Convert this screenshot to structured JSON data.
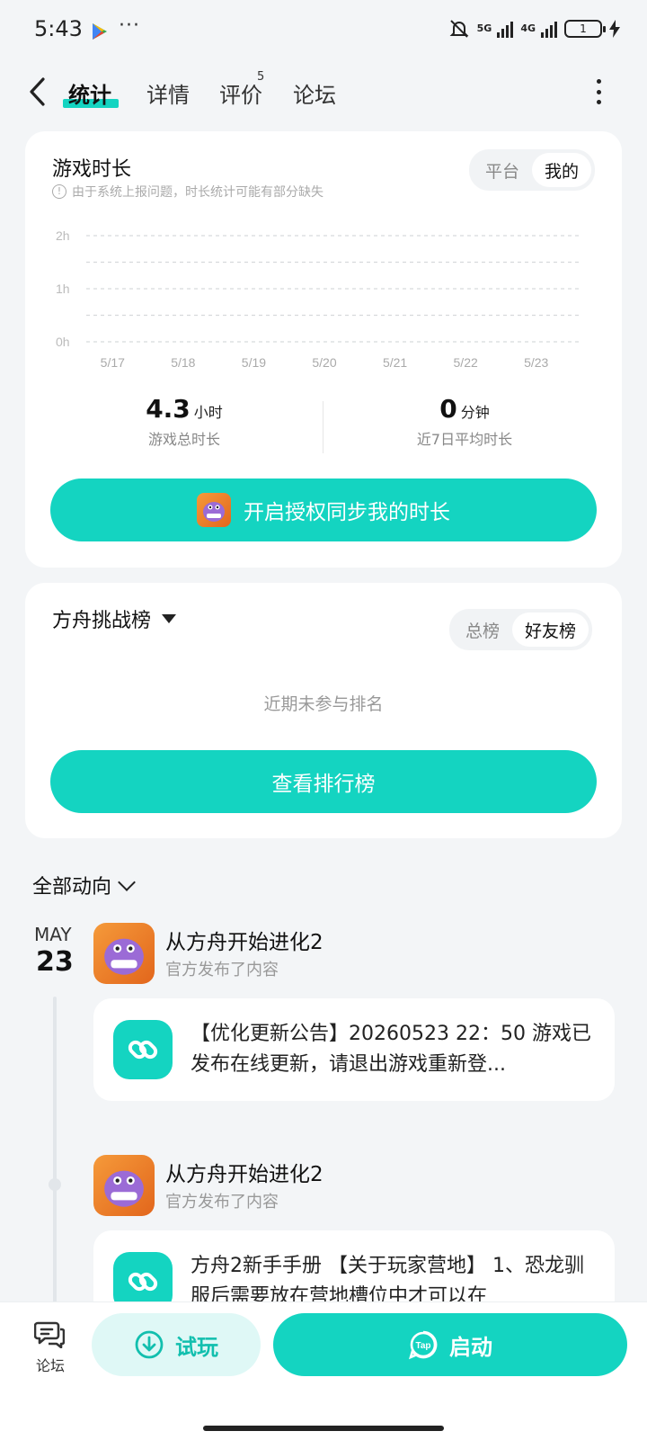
{
  "status_bar": {
    "time": "5:43",
    "more": "···",
    "net1": "5G",
    "net2": "4G",
    "battery": "1"
  },
  "nav": {
    "tabs": [
      {
        "label": "统计",
        "active": true
      },
      {
        "label": "详情",
        "active": false
      },
      {
        "label": "评价",
        "active": false,
        "badge": "5"
      },
      {
        "label": "论坛",
        "active": false
      }
    ]
  },
  "playtime": {
    "title": "游戏时长",
    "notice": "由于系统上报问题，时长统计可能有部分缺失",
    "toggle": [
      {
        "label": "平台",
        "active": false
      },
      {
        "label": "我的",
        "active": true
      }
    ],
    "chart_data": {
      "type": "bar",
      "title": "",
      "xlabel": "",
      "ylabel": "",
      "categories": [
        "5/17",
        "5/18",
        "5/19",
        "5/20",
        "5/21",
        "5/22",
        "5/23"
      ],
      "values": [
        0,
        0,
        0,
        0,
        0,
        0,
        0
      ],
      "yticks": [
        "2h",
        "1h",
        "0h"
      ],
      "ylim": [
        0,
        2
      ],
      "grid": true
    },
    "total": {
      "value": "4.3",
      "unit": "小时",
      "label": "游戏总时长"
    },
    "avg": {
      "value": "0",
      "unit": "分钟",
      "label": "近7日平均时长"
    },
    "sync_button": "开启授权同步我的时长"
  },
  "ranking": {
    "title": "方舟挑战榜",
    "toggle": [
      {
        "label": "总榜",
        "active": false
      },
      {
        "label": "好友榜",
        "active": true
      }
    ],
    "empty_text": "近期未参与排名",
    "view_button": "查看排行榜"
  },
  "feed": {
    "filter_label": "全部动向",
    "date": {
      "month": "MAY",
      "day": "23"
    },
    "posts": [
      {
        "author": "从方舟开始进化2",
        "action": "官方发布了内容",
        "text": "【优化更新公告】20260523 22：50 游戏已发布在线更新，请退出游戏重新登..."
      },
      {
        "author": "从方舟开始进化2",
        "action": "官方发布了内容",
        "text": "方舟2新手手册 【关于玩家营地】 1、恐龙驯服后需要放在营地槽位中才可以在"
      }
    ]
  },
  "bottom_bar": {
    "forum_label": "论坛",
    "trial_label": "试玩",
    "launch_label": "启动",
    "tap_logo": "Tap"
  }
}
